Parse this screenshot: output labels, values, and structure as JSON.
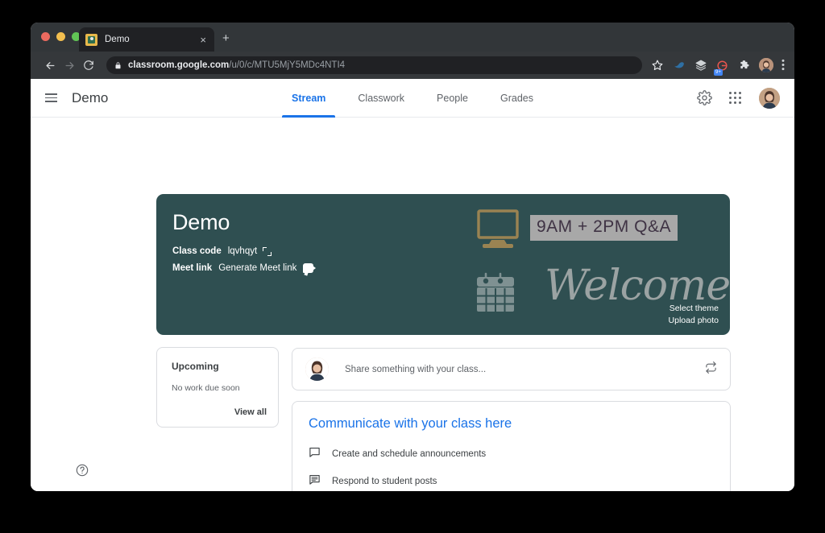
{
  "browser": {
    "tab": {
      "title": "Demo",
      "favicon": "classroom-favicon",
      "close_label": "×"
    },
    "new_tab_label": "+",
    "nav": {
      "back": "back-icon",
      "forward": "forward-icon",
      "reload": "reload-icon"
    },
    "omnibox": {
      "lock": "lock-icon",
      "domain": "classroom.google.com",
      "path": "/u/0/c/MTU5MjY5MDc4NTI4",
      "full_url": "classroom.google.com/u/0/c/MTU5MjY5MDc4NTI4"
    },
    "toolbar_icons": [
      {
        "name": "bookmark-star-icon"
      },
      {
        "name": "extension-bird-icon"
      },
      {
        "name": "extension-layers-icon"
      },
      {
        "name": "extension-grammarly-icon",
        "badge": "9+"
      },
      {
        "name": "extensions-puzzle-icon"
      },
      {
        "name": "profile-avatar-icon"
      },
      {
        "name": "chrome-menu-kebab-icon"
      }
    ]
  },
  "app": {
    "menu_icon": "hamburger-menu-icon",
    "title": "Demo",
    "tabs": [
      {
        "label": "Stream",
        "active": true
      },
      {
        "label": "Classwork",
        "active": false
      },
      {
        "label": "People",
        "active": false
      },
      {
        "label": "Grades",
        "active": false
      }
    ],
    "header_icons": [
      {
        "name": "settings-gear-icon"
      },
      {
        "name": "google-apps-grid-icon"
      },
      {
        "name": "account-avatar"
      }
    ]
  },
  "banner": {
    "class_name": "Demo",
    "class_code_label": "Class code",
    "class_code_value": "lqvhqyt",
    "class_code_expand_icon": "expand-class-code-icon",
    "meet_link_label": "Meet link",
    "meet_link_action": "Generate Meet link",
    "meet_icon": "google-meet-icon",
    "theme_art": {
      "monitor_icon": "computer-monitor-icon",
      "calendar_icon": "calendar-icon",
      "chip_text": "9AM + 2PM Q&A",
      "welcome_text": "Welcome!"
    },
    "select_theme": "Select theme",
    "upload_photo": "Upload photo",
    "background_color": "#2f4f51"
  },
  "upcoming": {
    "title": "Upcoming",
    "empty_message": "No work due soon",
    "view_all": "View all"
  },
  "share": {
    "avatar": "teacher-avatar",
    "placeholder": "Share something with your class...",
    "reorder_icon": "reorder-swap-icon"
  },
  "communicate": {
    "title": "Communicate with your class here",
    "items": [
      {
        "icon": "announcement-bubble-icon",
        "label": "Create and schedule announcements"
      },
      {
        "icon": "post-list-icon",
        "label": "Respond to student posts"
      }
    ]
  },
  "help": {
    "icon": "help-question-icon"
  },
  "colors": {
    "accent_blue": "#1a73e8",
    "banner_teal": "#2f4f51",
    "chrome_dark": "#323639",
    "omnibox_dark": "#202124",
    "border_gray": "#dadce0"
  }
}
